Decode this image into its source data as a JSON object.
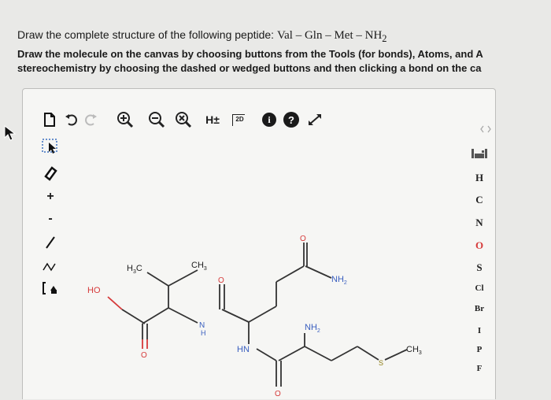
{
  "question": {
    "line1_prefix": "Draw the complete structure of the following peptide: ",
    "peptide": "Val – Gln – Met – NH",
    "peptide_subscript": "2",
    "line2": "Draw the molecule on the canvas by choosing buttons from the Tools (for bonds), Atoms, and A",
    "line3": "stereochemistry by choosing the dashed or wedged buttons and then clicking a bond on the ca"
  },
  "toolbar": {
    "h_toggle_label": "H±",
    "two_d_label": "2D",
    "info_label": "i",
    "help_label": "?"
  },
  "left_tools": {
    "plus_label": "+",
    "minus_label": "-",
    "chain_label": "~"
  },
  "atoms": [
    "H",
    "C",
    "N",
    "O",
    "S",
    "Cl",
    "Br",
    "I",
    "P",
    "F"
  ],
  "molecule": {
    "h3c_left": "H",
    "h3c_left_sub": "3",
    "h3c_left_c": "C",
    "ch3_right": "CH",
    "ch3_right_sub": "3",
    "ho": "HO",
    "n_amide1": "N",
    "h_amide1": "H",
    "hn": "HN",
    "nh2_side": "NH",
    "nh2_side_sub": "2",
    "nh2_term": "NH",
    "nh2_term_sub": "2",
    "s_atom": "S",
    "ch3_met": "CH",
    "ch3_met_sub": "3",
    "o_label": "O"
  },
  "colors": {
    "oxygen": "#d63a3a",
    "nitrogen": "#3a5fbf",
    "bond": "#333333",
    "info_bg": "#1a1a1a",
    "accent": "#222222"
  }
}
